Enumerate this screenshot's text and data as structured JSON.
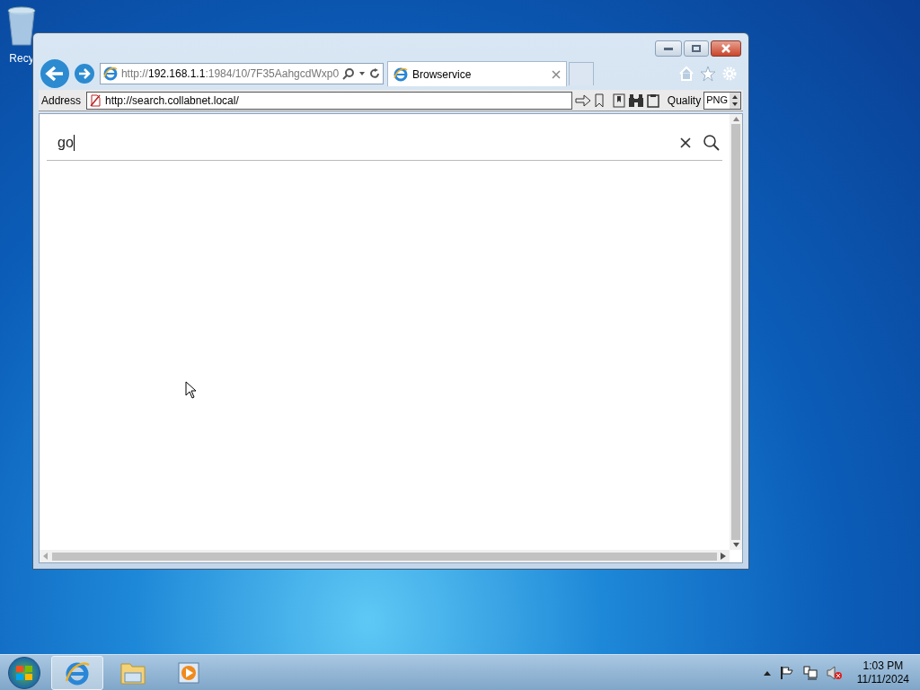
{
  "desktop_icons": [
    {
      "label": "Recy"
    }
  ],
  "browser": {
    "ie_url": {
      "prefix": "http://",
      "host": "192.168.1.1",
      "rest": ":1984/10/7F35AahgcdWxp0"
    },
    "tabs": [
      {
        "label": "Browservice",
        "selected": true
      }
    ],
    "address_label": "Address",
    "address": "http://search.collabnet.local/",
    "quality_label": "Quality",
    "quality_value": "PNG"
  },
  "page": {
    "search": {
      "value": "go"
    }
  },
  "taskbar": {
    "items": [
      {
        "kind": "ie",
        "selected": true
      },
      {
        "kind": "explorer",
        "selected": false
      },
      {
        "kind": "media",
        "selected": false
      }
    ],
    "clock": {
      "time": "1:03 PM",
      "date": "11/11/2024"
    }
  }
}
